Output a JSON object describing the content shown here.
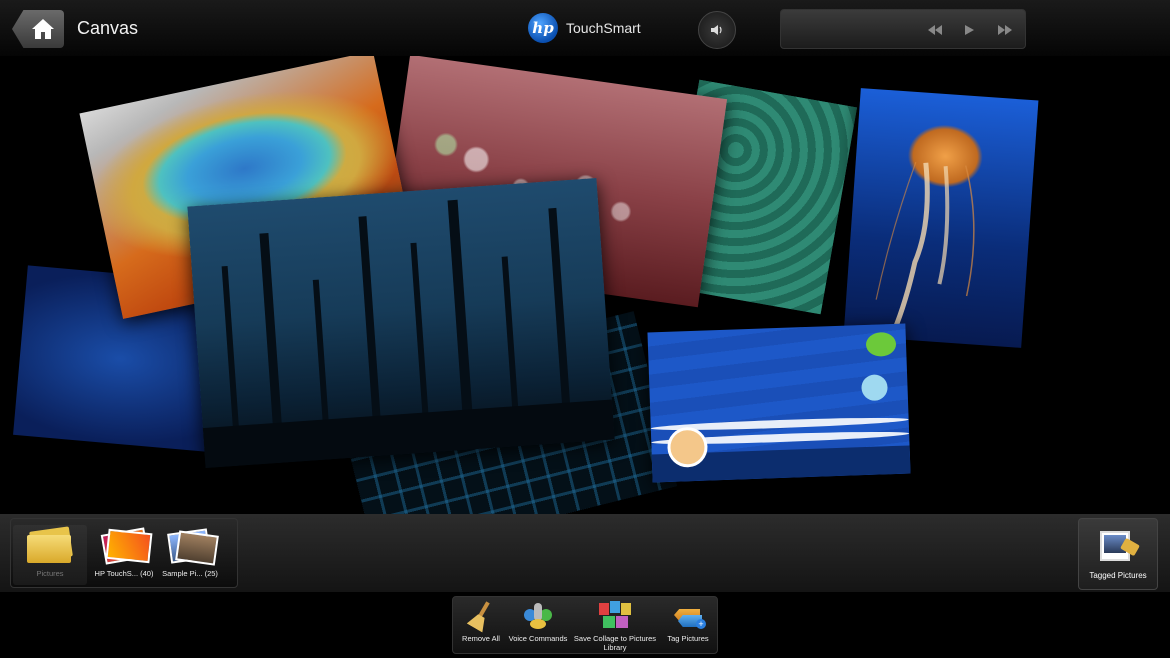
{
  "header": {
    "title": "Canvas",
    "brand_logo": "hp",
    "brand_name": "TouchSmart"
  },
  "icons": {
    "home": "home-icon",
    "volume": "speaker-icon",
    "rewind": "rewind-icon",
    "play": "play-icon",
    "fast_forward": "fast-forward-icon"
  },
  "sources": [
    {
      "label": "Pictures"
    },
    {
      "label": "HP TouchS... (40)"
    },
    {
      "label": "Sample Pi... (25)"
    }
  ],
  "tagged": {
    "label": "Tagged Pictures"
  },
  "actions": [
    {
      "label": "Remove All"
    },
    {
      "label": "Voice Commands"
    },
    {
      "label": "Save Collage to Pictures Library"
    },
    {
      "label": "Tag Pictures"
    }
  ],
  "colors": {
    "accent": "#0a4fb0",
    "background": "#000000"
  }
}
